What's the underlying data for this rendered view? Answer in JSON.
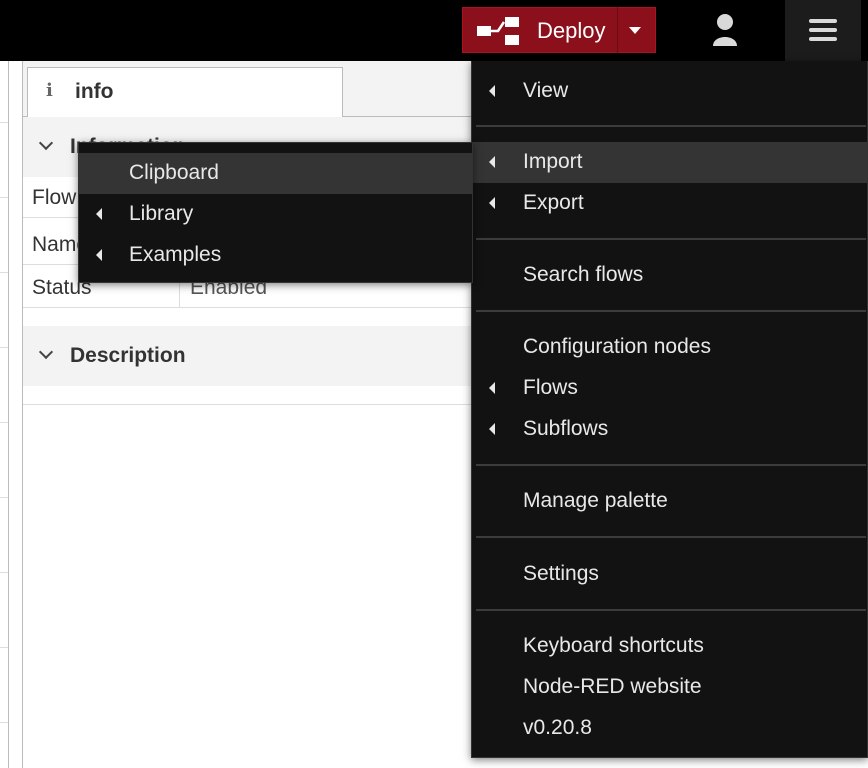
{
  "header": {
    "deploy_label": "Deploy",
    "deploy_icon": "deploy-flow-icon",
    "user_icon": "user-icon",
    "menu_icon": "hamburger-menu-icon",
    "deploy_color": "#8c101c"
  },
  "sidebar": {
    "tab": {
      "icon": "i",
      "label": "info"
    },
    "sections": {
      "information": {
        "title": "Information"
      },
      "description": {
        "title": "Description"
      }
    },
    "properties": [
      {
        "key": "Flow",
        "value": ""
      },
      {
        "key": "Name",
        "value": ""
      },
      {
        "key": "Status",
        "value": "Enabled"
      }
    ]
  },
  "main_menu": {
    "items": [
      {
        "label": "View",
        "has_submenu": true
      },
      {
        "label": "Import",
        "has_submenu": true,
        "active": true
      },
      {
        "label": "Export",
        "has_submenu": true
      },
      {
        "label": "Search flows",
        "has_submenu": false
      },
      {
        "label": "Configuration nodes",
        "has_submenu": false
      },
      {
        "label": "Flows",
        "has_submenu": true
      },
      {
        "label": "Subflows",
        "has_submenu": true
      },
      {
        "label": "Manage palette",
        "has_submenu": false
      },
      {
        "label": "Settings",
        "has_submenu": false
      },
      {
        "label": "Keyboard shortcuts",
        "has_submenu": false
      },
      {
        "label": "Node-RED website",
        "has_submenu": false
      },
      {
        "label": "v0.20.8",
        "has_submenu": false
      }
    ]
  },
  "import_submenu": {
    "items": [
      {
        "label": "Clipboard",
        "has_submenu": false,
        "active": true
      },
      {
        "label": "Library",
        "has_submenu": true
      },
      {
        "label": "Examples",
        "has_submenu": true
      }
    ]
  }
}
